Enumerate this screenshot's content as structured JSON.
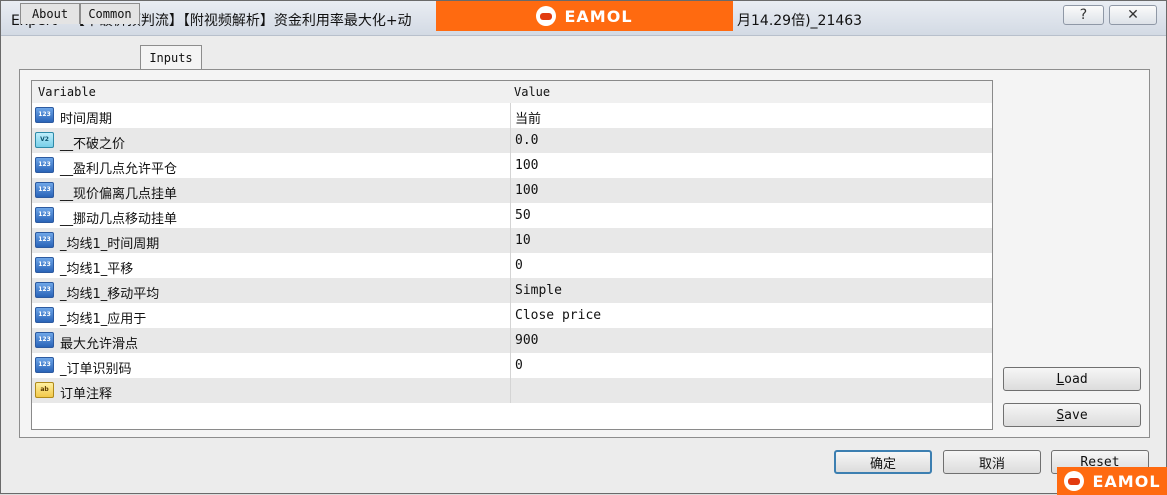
{
  "window": {
    "title_left": "Expert - 【不破价预判流】【附视频解析】资金利用率最大化+动",
    "title_right": "月14.29倍)_21463",
    "help_label": "?",
    "close_label": "✕"
  },
  "watermark": {
    "text": "EAMOL"
  },
  "tabs": [
    {
      "label": "About"
    },
    {
      "label": "Common"
    },
    {
      "label": "Inputs"
    }
  ],
  "grid": {
    "col_variable": "Variable",
    "col_value": "Value",
    "rows": [
      {
        "type": "int",
        "icon": "123",
        "name": "时间周期",
        "value": "当前"
      },
      {
        "type": "double",
        "icon": "V2",
        "name": "__不破之价",
        "value": "0.0"
      },
      {
        "type": "int",
        "icon": "123",
        "name": "__盈利几点允许平仓",
        "value": "100"
      },
      {
        "type": "int",
        "icon": "123",
        "name": "__现价偏离几点挂单",
        "value": "100"
      },
      {
        "type": "int",
        "icon": "123",
        "name": "__挪动几点移动挂单",
        "value": "50"
      },
      {
        "type": "int",
        "icon": "123",
        "name": "_均线1_时间周期",
        "value": "10"
      },
      {
        "type": "int",
        "icon": "123",
        "name": "_均线1_平移",
        "value": "0"
      },
      {
        "type": "int",
        "icon": "123",
        "name": "_均线1_移动平均",
        "value": "Simple"
      },
      {
        "type": "int",
        "icon": "123",
        "name": "_均线1_应用于",
        "value": "Close price"
      },
      {
        "type": "int",
        "icon": "123",
        "name": "最大允许滑点",
        "value": "900"
      },
      {
        "type": "int",
        "icon": "123",
        "name": "_订单识别码",
        "value": "0"
      },
      {
        "type": "string",
        "icon": "ab",
        "name": "订单注释",
        "value": ""
      }
    ]
  },
  "buttons": {
    "load_u": "L",
    "load_rest": "oad",
    "save_u": "S",
    "save_rest": "ave",
    "ok": "确定",
    "cancel": "取消",
    "reset": "Reset"
  }
}
